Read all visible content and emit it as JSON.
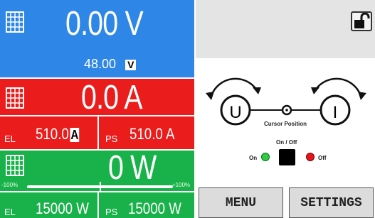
{
  "voltage": {
    "value": "0.00 V",
    "setpoint": "48.00",
    "unit": "V"
  },
  "current": {
    "value": "0.0 A"
  },
  "limits": {
    "el_label": "EL",
    "el_value": "510.0",
    "el_unit": "A",
    "ps_label": "PS",
    "ps_value": "510.0 A"
  },
  "power": {
    "value": "0 W",
    "slider_min": "-100%",
    "slider_max": "+100%",
    "slider_level_percent": 0,
    "el_label": "EL",
    "el_value": "15000 W",
    "ps_label": "PS",
    "ps_value": "15000 W"
  },
  "controls": {
    "left_knob": "U",
    "right_knob": "I",
    "cursor_label": "Cursor Position",
    "onoff_title": "On / Off",
    "on_label": "On",
    "off_label": "Off"
  },
  "buttons": {
    "menu": "MENU",
    "settings": "SETTINGS"
  },
  "colors": {
    "voltage": "#2e86e6",
    "current": "#ea1c1c",
    "power": "#19b24a",
    "on": "#2ecc40",
    "off": "#e8141c"
  }
}
